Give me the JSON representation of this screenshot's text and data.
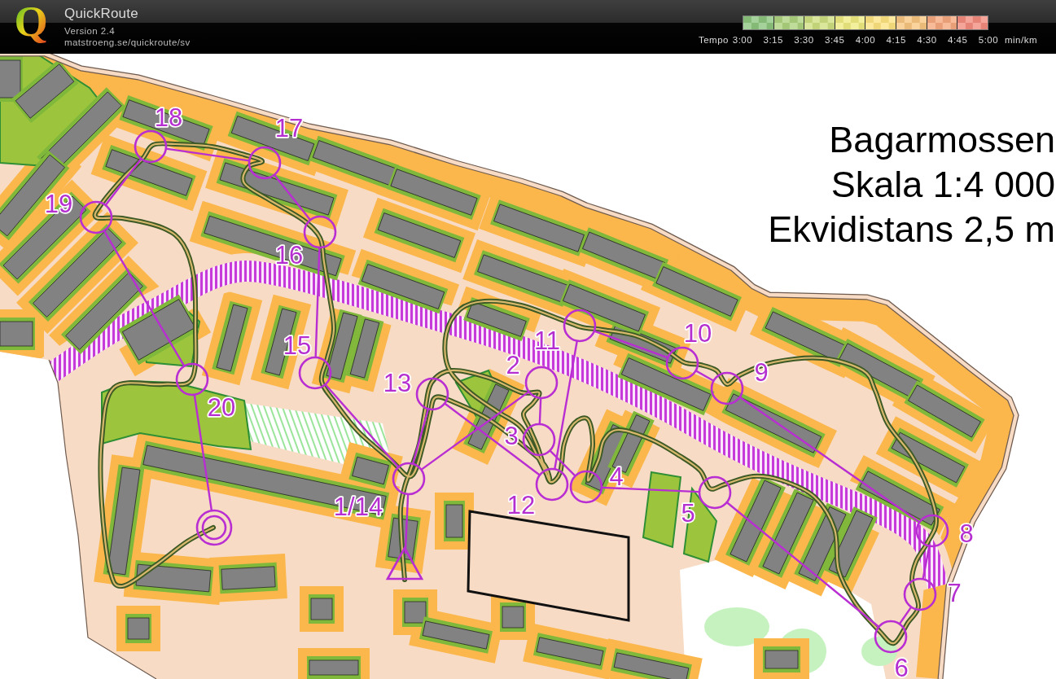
{
  "header": {
    "logo_letter": "Q",
    "app_name": "QuickRoute",
    "version": "Version 2.4",
    "url": "matstroeng.se/quickroute/sv"
  },
  "tempo_legend": {
    "label": "Tempo",
    "ticks": [
      "3:00",
      "3:15",
      "3:30",
      "3:45",
      "4:00",
      "4:15",
      "4:30",
      "4:45",
      "5:00"
    ],
    "unit": "min/km"
  },
  "map": {
    "title_lines": [
      "Bagarmossen",
      "Skala 1:4 000",
      "Ekvidistans 2,5 m"
    ],
    "course": {
      "controls": [
        {
          "kind": "control",
          "number": "18"
        },
        {
          "kind": "control",
          "number": "17"
        },
        {
          "kind": "control",
          "number": "19"
        },
        {
          "kind": "control",
          "number": "16"
        },
        {
          "kind": "control",
          "number": "11"
        },
        {
          "kind": "control",
          "number": "10"
        },
        {
          "kind": "control",
          "number": "15"
        },
        {
          "kind": "control",
          "number": "2"
        },
        {
          "kind": "control",
          "number": "9"
        },
        {
          "kind": "control",
          "number": "20"
        },
        {
          "kind": "control",
          "number": "13"
        },
        {
          "kind": "control",
          "number": "3"
        },
        {
          "kind": "control",
          "number": "1/14"
        },
        {
          "kind": "control",
          "number": "4"
        },
        {
          "kind": "control",
          "number": "12"
        },
        {
          "kind": "control",
          "number": "5"
        },
        {
          "kind": "finish"
        },
        {
          "kind": "control",
          "number": "8"
        },
        {
          "kind": "start"
        },
        {
          "kind": "control",
          "number": "7"
        },
        {
          "kind": "control",
          "number": "6"
        }
      ]
    }
  }
}
